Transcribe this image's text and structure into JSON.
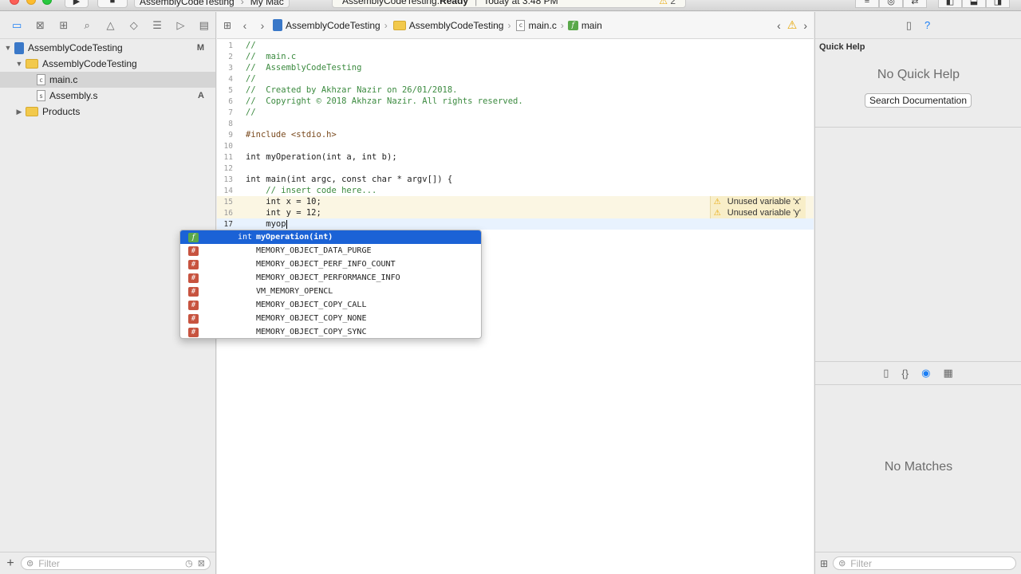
{
  "window": {
    "scheme_target": "AssemblyCodeTesting",
    "scheme_device": "My Mac",
    "status_prefix": "AssemblyCodeTesting: ",
    "status_state": "Ready",
    "status_time": "Today at 3:48 PM",
    "warning_count": "2"
  },
  "navigator": {
    "project": "AssemblyCodeTesting",
    "project_badge": "M",
    "group": "AssemblyCodeTesting",
    "file_main": "main.c",
    "file_asm": "Assembly.s",
    "file_asm_badge": "A",
    "products": "Products",
    "filter_placeholder": "Filter"
  },
  "jumpbar": {
    "project": "AssemblyCodeTesting",
    "group": "AssemblyCodeTesting",
    "file": "main.c",
    "symbol": "main"
  },
  "code": {
    "lines": [
      "//",
      "//  main.c",
      "//  AssemblyCodeTesting",
      "//",
      "//  Created by Akhzar Nazir on 26/01/2018.",
      "//  Copyright © 2018 Akhzar Nazir. All rights reserved.",
      "//",
      "",
      "#include <stdio.h>",
      "",
      "int myOperation(int a, int b);",
      "",
      "int main(int argc, const char * argv[]) {",
      "    // insert code here...",
      "    int x = 10;",
      "    int y = 12;",
      "    myop"
    ],
    "issue_x": "Unused variable 'x'",
    "issue_y": "Unused variable 'y'"
  },
  "completion": {
    "items": [
      {
        "kind": "f",
        "type": "int",
        "text": "myOperation(int)"
      },
      {
        "kind": "#",
        "type": "",
        "text": "MEMORY_OBJECT_DATA_PURGE"
      },
      {
        "kind": "#",
        "type": "",
        "text": "MEMORY_OBJECT_PERF_INFO_COUNT"
      },
      {
        "kind": "#",
        "type": "",
        "text": "MEMORY_OBJECT_PERFORMANCE_INFO"
      },
      {
        "kind": "#",
        "type": "",
        "text": "VM_MEMORY_OPENCL"
      },
      {
        "kind": "#",
        "type": "",
        "text": "MEMORY_OBJECT_COPY_CALL"
      },
      {
        "kind": "#",
        "type": "",
        "text": "MEMORY_OBJECT_COPY_NONE"
      },
      {
        "kind": "#",
        "type": "",
        "text": "MEMORY_OBJECT_COPY_SYNC"
      }
    ]
  },
  "utilities": {
    "quick_help_title": "Quick Help",
    "no_quick_help": "No Quick Help",
    "search_docs": "Search Documentation",
    "no_matches": "No Matches",
    "filter_placeholder": "Filter"
  }
}
